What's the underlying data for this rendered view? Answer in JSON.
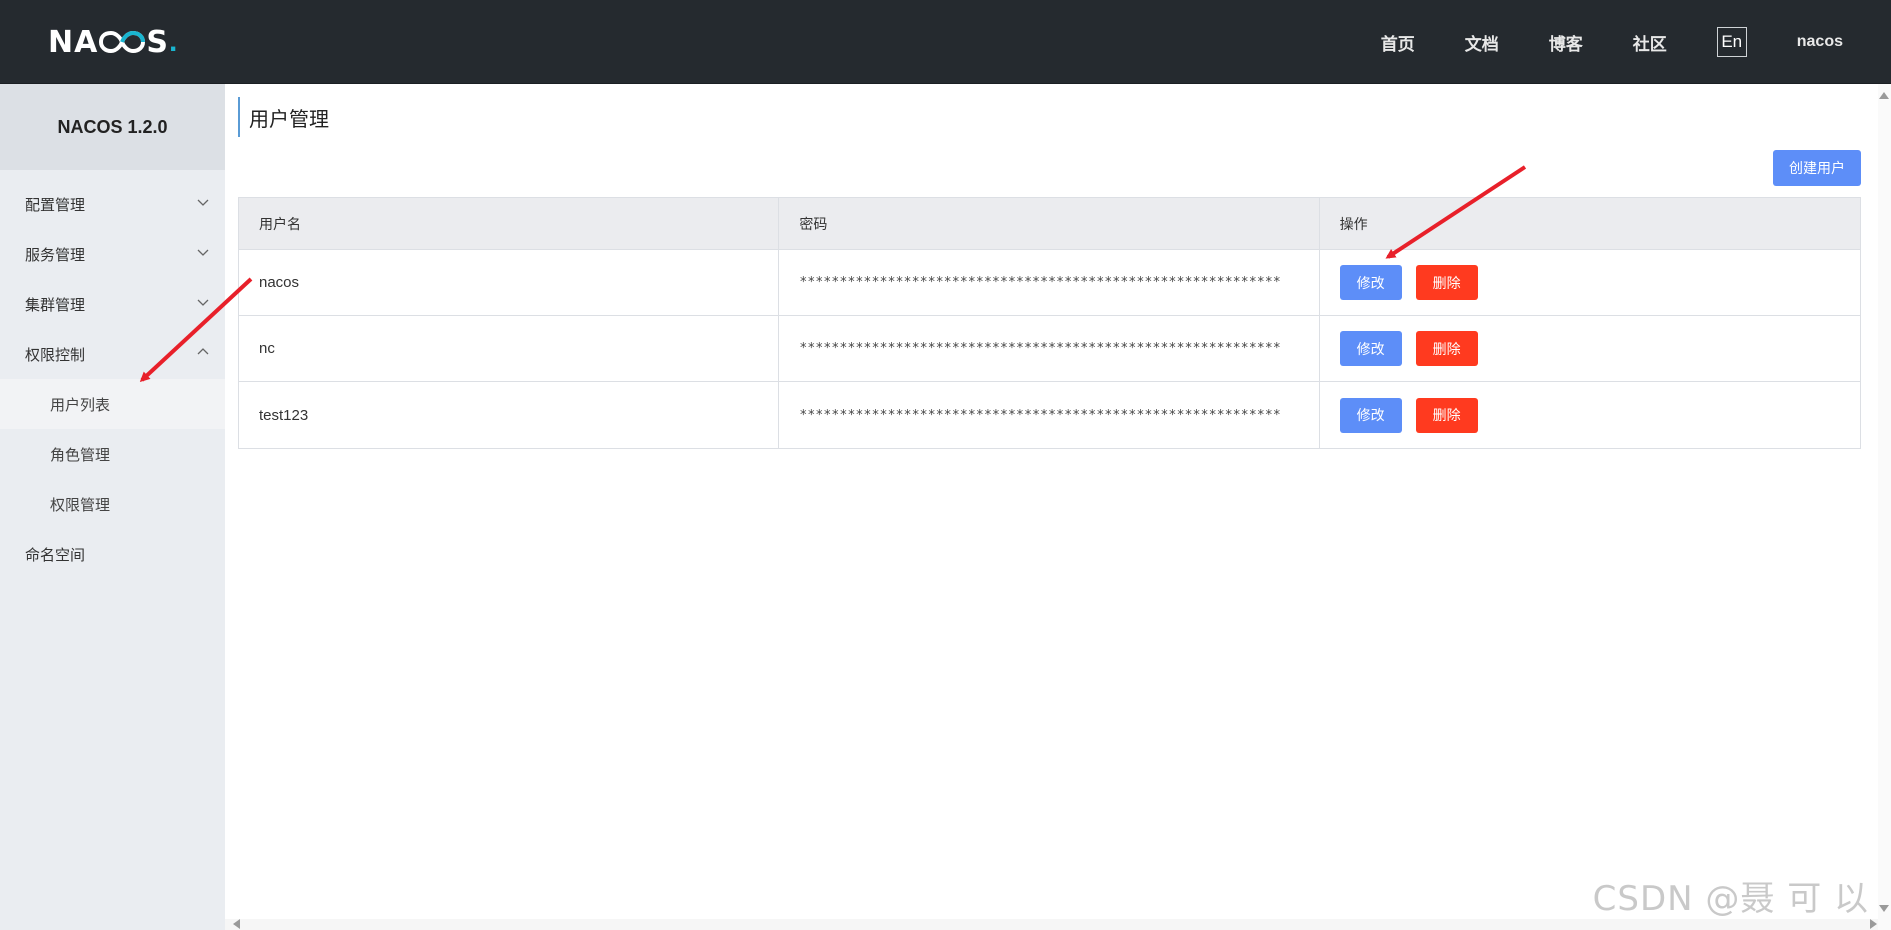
{
  "header": {
    "logo_text_a": "NA",
    "logo_text_b": "S",
    "logo_dot": ".",
    "nav": [
      "首页",
      "文档",
      "博客",
      "社区"
    ],
    "lang": "En",
    "user": "nacos",
    "colors": {
      "bg": "#252a2f",
      "logo_accent": "#19b5d0"
    }
  },
  "sidebar": {
    "title": "NACOS 1.2.0",
    "items": [
      {
        "label": "配置管理",
        "icon": "chevron-down-icon"
      },
      {
        "label": "服务管理",
        "icon": "chevron-down-icon"
      },
      {
        "label": "集群管理",
        "icon": "chevron-down-icon"
      },
      {
        "label": "权限控制",
        "icon": "chevron-up-icon",
        "children": [
          "用户列表",
          "角色管理",
          "权限管理"
        ],
        "active_child": "用户列表"
      },
      {
        "label": "命名空间"
      }
    ]
  },
  "main": {
    "title": "用户管理",
    "create_button": "创建用户",
    "table": {
      "columns": [
        "用户名",
        "密码",
        "操作"
      ],
      "rows": [
        {
          "username": "nacos",
          "password": "************************************************************"
        },
        {
          "username": "nc",
          "password": "************************************************************"
        },
        {
          "username": "test123",
          "password": "************************************************************"
        }
      ],
      "edit_label": "修改",
      "delete_label": "删除"
    },
    "colors": {
      "primary": "#5d8ef8",
      "danger": "#ff3a1f"
    }
  },
  "watermark": "CSDN @聂 可 以"
}
